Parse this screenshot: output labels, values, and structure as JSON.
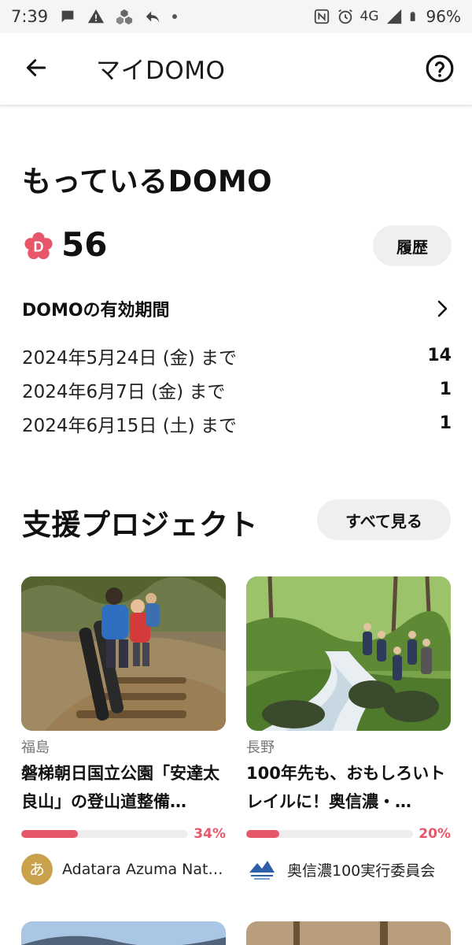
{
  "status_bar": {
    "time": "7:39",
    "network": "4G",
    "battery": "96%",
    "left_icons": [
      "chat-bubble-icon",
      "warning-icon",
      "apps-icon",
      "reply-icon",
      "dot-icon"
    ],
    "right_icons": [
      "nfc-icon",
      "alarm-icon",
      "signal-icon",
      "battery-icon"
    ]
  },
  "app_bar": {
    "title": "マイDOMO",
    "back_icon": "arrow-left-icon",
    "help_icon": "help-circle-icon"
  },
  "domo": {
    "section_title": "もっているDOMO",
    "points": "56",
    "badge_letter": "D",
    "history_label": "履歴",
    "validity_label": "DOMOの有効期間",
    "expirations": [
      {
        "date": "2024年5月24日 (金) まで",
        "count": "14"
      },
      {
        "date": "2024年6月7日 (金) まで",
        "count": "1"
      },
      {
        "date": "2024年6月15日 (土) まで",
        "count": "1"
      }
    ]
  },
  "projects": {
    "section_title": "支援プロジェクト",
    "see_all_label": "すべて見る",
    "items": [
      {
        "region": "福島",
        "title": "磐梯朝日国立公園「安達太良山」の登山道整備…",
        "progress": 0.34,
        "progress_label": "34%",
        "org_name": "Adatara Azuma Nat…",
        "org_logo_letter": "あ",
        "image": "hikers-carrying-pipes-on-trail"
      },
      {
        "region": "長野",
        "title": "100年先も、おもしろいトレイルに！奥信濃・…",
        "progress": 0.2,
        "progress_label": "20%",
        "org_name": "奥信濃100実行委員会",
        "image": "group-by-forest-stream"
      }
    ]
  },
  "colors": {
    "accent": "#e8566a",
    "button_bg": "#efefef",
    "status_bar_bg": "#f5f5f5"
  }
}
